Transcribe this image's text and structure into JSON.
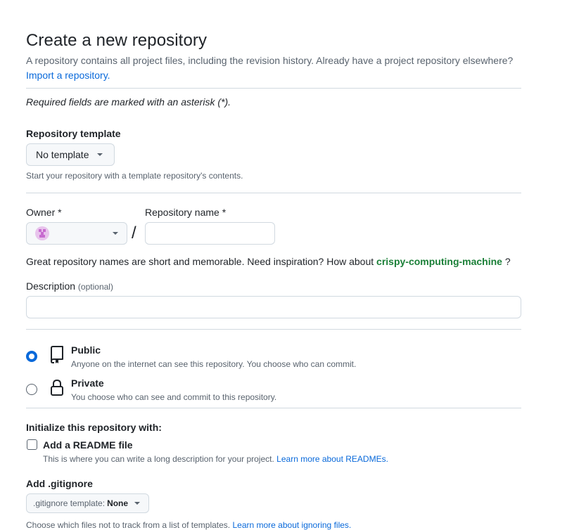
{
  "header": {
    "title": "Create a new repository",
    "description": "A repository contains all project files, including the revision history. Already have a project repository elsewhere?",
    "import_link": "Import a repository."
  },
  "required_note": "Required fields are marked with an asterisk (*).",
  "template": {
    "label": "Repository template",
    "button": "No template",
    "help": "Start your repository with a template repository's contents."
  },
  "owner": {
    "label": "Owner *",
    "value": ""
  },
  "separator": "/",
  "repo_name": {
    "label": "Repository name *",
    "value": ""
  },
  "suggestion": {
    "prefix": "Great repository names are short and memorable. Need inspiration? How about",
    "name": "crispy-computing-machine",
    "suffix": "?"
  },
  "description_field": {
    "label": "Description",
    "optional": "(optional)",
    "value": ""
  },
  "visibility": {
    "selected": "public",
    "public": {
      "title": "Public",
      "desc": "Anyone on the internet can see this repository. You choose who can commit."
    },
    "private": {
      "title": "Private",
      "desc": "You choose who can see and commit to this repository."
    }
  },
  "initialize": {
    "label": "Initialize this repository with:",
    "readme": {
      "label": "Add a README file",
      "checked": false,
      "desc": "This is where you can write a long description for your project.",
      "link": "Learn more about READMEs."
    }
  },
  "gitignore": {
    "label": "Add .gitignore",
    "button_prefix": ".gitignore template:",
    "button_value": "None",
    "help": "Choose which files not to track from a list of templates.",
    "link": "Learn more about ignoring files."
  },
  "colors": {
    "accent": "#0969da",
    "suggestion": "#1a7f37",
    "border": "#d1d9e0",
    "avatar": "#c76bcf"
  }
}
